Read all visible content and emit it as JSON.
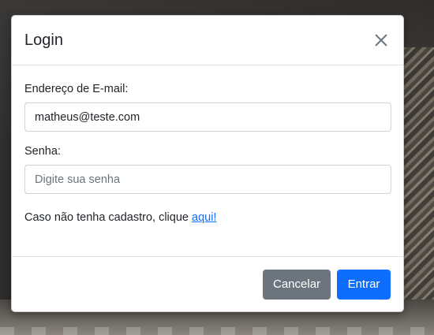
{
  "dialog": {
    "title": "Login"
  },
  "form": {
    "email": {
      "label": "Endereço de E-mail:",
      "value": "matheus@teste.com"
    },
    "password": {
      "label": "Senha:",
      "value": "",
      "placeholder": "Digite sua senha"
    },
    "hint_text": "Caso não tenha cadastro, clique ",
    "hint_link": "aqui!"
  },
  "footer": {
    "cancel_label": "Cancelar",
    "submit_label": "Entrar"
  },
  "icons": {
    "close": "close-icon"
  },
  "colors": {
    "primary": "#0d6efd",
    "secondary": "#6c757d",
    "link": "#0d6efd"
  }
}
